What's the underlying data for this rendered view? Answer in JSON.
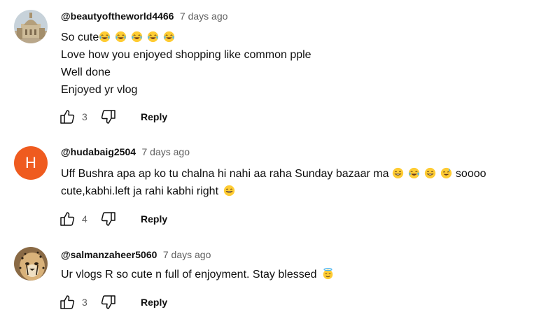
{
  "comments": [
    {
      "author": "@beautyoftheworld4466",
      "time": "7 days ago",
      "lines": [
        "So cute",
        "Love how you enjoyed shopping like common pple",
        "Well done",
        "Enjoyed yr vlog"
      ],
      "likes": "3",
      "reply_label": "Reply",
      "avatar": "building-photo"
    },
    {
      "author": "@hudabaig2504",
      "time": "7 days ago",
      "line1_text": "Uff Bushra apa ap ko tu chalna hi nahi aa raha Sunday bazaar ma",
      "line1_tail": "soooo",
      "line2_text": "cute,kabhi.left ja rahi kabhi right",
      "likes": "4",
      "reply_label": "Reply",
      "avatar_letter": "H",
      "avatar_color": "#ef5b1f"
    },
    {
      "author": "@salmanzaheer5060",
      "time": "7 days ago",
      "lines": [
        "Ur vlogs R so cute n full of enjoyment. Stay blessed"
      ],
      "likes": "3",
      "reply_label": "Reply",
      "avatar": "cheetah-photo"
    }
  ],
  "colors": {
    "text": "#0f0f0f",
    "meta": "#606060",
    "emoji": "#ffcc33"
  },
  "icons": [
    "thumbs-up-icon",
    "thumbs-down-icon",
    "tears-of-joy-emoji",
    "grinning-emoji",
    "sweat-smile-emoji",
    "halo-emoji"
  ]
}
